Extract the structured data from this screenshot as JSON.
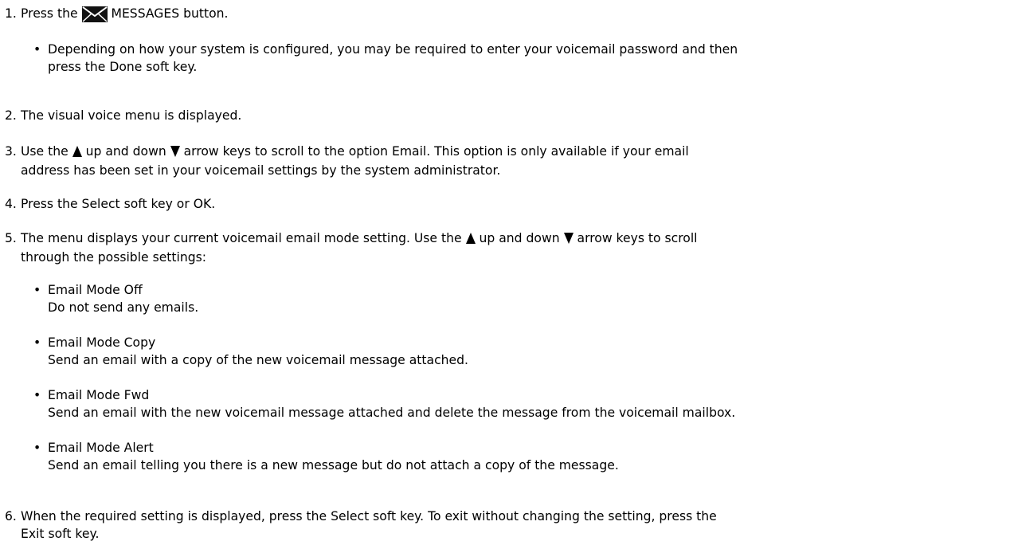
{
  "steps": [
    {
      "num": "1.",
      "text_pre": "Press the ",
      "icon": "envelope-icon",
      "text_post": " MESSAGES button.",
      "bullets": [
        {
          "line1": "Depending on how your system is configured, you may be required to enter your voicemail password and then",
          "line2": "press the Done soft key."
        }
      ]
    },
    {
      "num": "2.",
      "line1": "The visual voice menu is displayed."
    },
    {
      "num": "3.",
      "seg1": "Use the ",
      "up_icon": "up-arrow-icon",
      "seg2": " up and down ",
      "down_icon": "down-arrow-icon",
      "seg3": " arrow keys to scroll to the option Email. This option is only available if your email",
      "line2": "address has been set in your voicemail settings by the system administrator."
    },
    {
      "num": "4.",
      "line1": "Press the Select soft key or OK."
    },
    {
      "num": "5.",
      "seg1": "The menu displays your current voicemail email mode setting. Use the ",
      "up_icon": "up-arrow-icon",
      "seg2": " up and down ",
      "down_icon": "down-arrow-icon",
      "seg3": " arrow keys to scroll",
      "line2": "through the possible settings:",
      "options": [
        {
          "title": "Email Mode Off",
          "desc": "Do not send any emails."
        },
        {
          "title": "Email Mode Copy",
          "desc": "Send an email with a copy of the new voicemail message attached."
        },
        {
          "title": "Email Mode Fwd",
          "desc": "Send an email with the new voicemail message attached and delete the message from the voicemail mailbox."
        },
        {
          "title": "Email Mode Alert",
          "desc": "Send an email telling you there is a new message but do not attach a copy of the message."
        }
      ]
    },
    {
      "num": "6.",
      "line1": "When the required setting is displayed, press the Select soft key. To exit without changing the setting, press the",
      "line2": "Exit soft key."
    }
  ]
}
